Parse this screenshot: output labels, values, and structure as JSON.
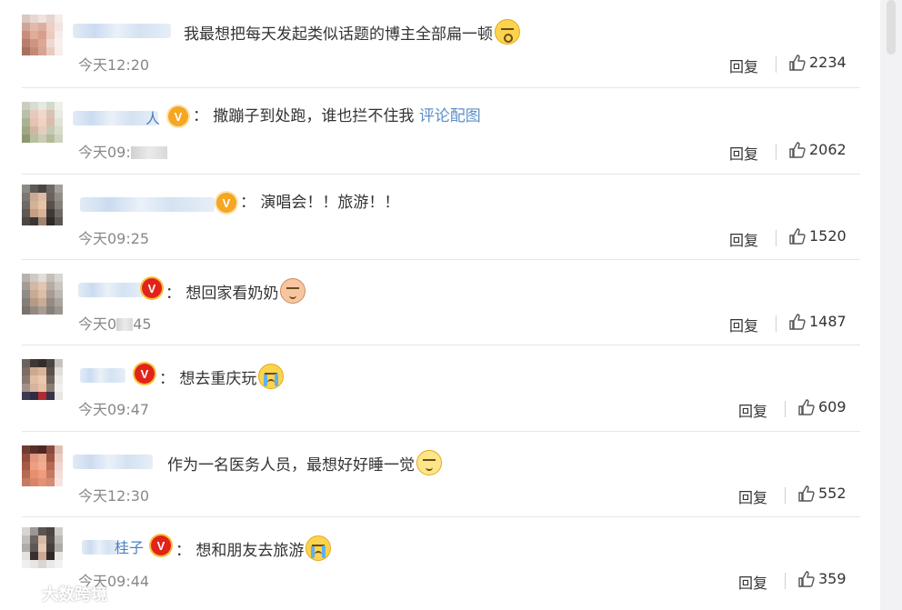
{
  "comments": [
    {
      "name_visible": "",
      "badge": "",
      "text_parts": [
        "我最想把每天发起类似话题的博主全部扁一顿"
      ],
      "link": "",
      "emoji": "scream",
      "time": "今天12:20",
      "time_masked": false,
      "reply_label": "回复",
      "likes": "2234"
    },
    {
      "name_visible": "人",
      "badge": "V",
      "text_parts": [
        "撒蹦子到处跑，谁也拦不住我"
      ],
      "link": "评论配图",
      "emoji": "",
      "time": "今天09:",
      "time_masked": true,
      "reply_label": "回复",
      "likes": "2062"
    },
    {
      "name_visible": "",
      "badge": "V",
      "text_parts": [
        "演唱会！！旅游！！"
      ],
      "link": "",
      "emoji": "",
      "time": "今天09:25",
      "time_masked": false,
      "reply_label": "回复",
      "likes": "1520"
    },
    {
      "name_visible": "",
      "badge": "V",
      "text_parts": [
        "想回家看奶奶"
      ],
      "link": "",
      "emoji": "granny",
      "time": "今天0",
      "time_suffix": "45",
      "time_masked": true,
      "reply_label": "回复",
      "likes": "1487"
    },
    {
      "name_visible": "",
      "badge": "V",
      "text_parts": [
        "想去重庆玩"
      ],
      "link": "",
      "emoji": "cry",
      "time": "今天09:47",
      "time_masked": false,
      "reply_label": "回复",
      "likes": "609"
    },
    {
      "name_visible": "",
      "badge": "",
      "text_parts": [
        "作为一名医务人员，最想好好睡一觉"
      ],
      "link": "",
      "emoji": "sleepy",
      "time": "今天12:30",
      "time_masked": false,
      "reply_label": "回复",
      "likes": "552"
    },
    {
      "name_visible": "桂子",
      "badge": "V",
      "text_parts": [
        "想和朋友去旅游"
      ],
      "link": "",
      "emoji": "cry",
      "time": "今天09:44",
      "time_masked": false,
      "reply_label": "回复",
      "likes": "359"
    }
  ],
  "watermark": "大数跨境",
  "colors": {
    "link": "#5b8fc9",
    "name": "#4a7fbf",
    "text": "#333333",
    "time": "#888888",
    "badge_gold": "#f5a623",
    "badge_red": "#e2231a"
  }
}
